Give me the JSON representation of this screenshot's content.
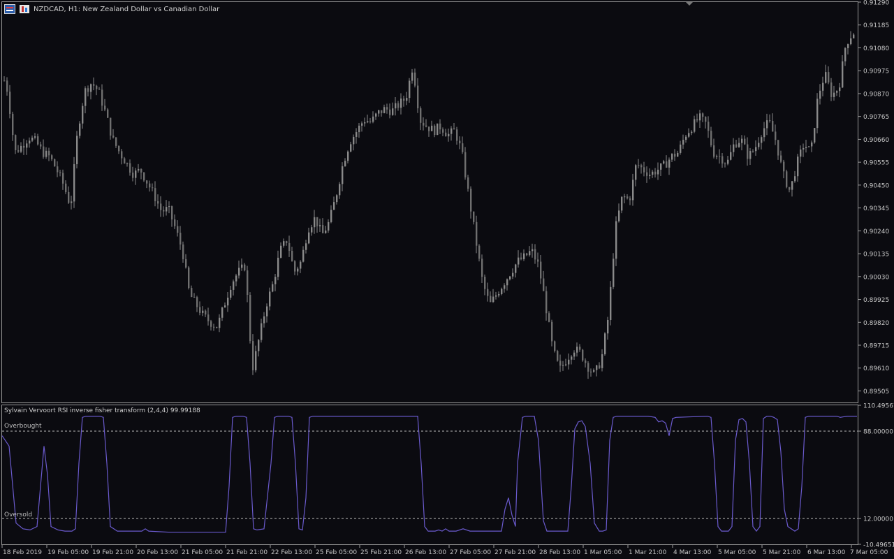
{
  "window": {
    "symbol_title": "NZDCAD, H1:  New Zealand Dollar vs Canadian Dollar",
    "icons": [
      "symbol-flag-icon",
      "timeframe-icon"
    ]
  },
  "price_axis": [
    "0.91290",
    "0.91185",
    "0.91080",
    "0.90975",
    "0.90870",
    "0.90765",
    "0.90660",
    "0.90555",
    "0.90450",
    "0.90345",
    "0.90240",
    "0.90135",
    "0.90030",
    "0.89925",
    "0.89820",
    "0.89715",
    "0.89610",
    "0.89505"
  ],
  "indicator": {
    "title": "Sylvain Vervoort RSI inverse fisher transform (2,4,4) 99.99188",
    "axis": [
      "110.49567",
      "88.00000",
      "12.00000",
      "-10.49651"
    ],
    "overbought_label": "Overbought",
    "oversold_label": "Oversold",
    "overbought_level": 88,
    "oversold_level": 12,
    "line_color": "#6a5acd"
  },
  "time_axis": [
    "18 Feb 2019",
    "19 Feb 05:00",
    "19 Feb 21:00",
    "20 Feb 13:00",
    "21 Feb 05:00",
    "21 Feb 21:00",
    "22 Feb 13:00",
    "25 Feb 05:00",
    "25 Feb 21:00",
    "26 Feb 13:00",
    "27 Feb 05:00",
    "27 Feb 21:00",
    "28 Feb 13:00",
    "1 Mar 05:00",
    "1 Mar 21:00",
    "4 Mar 13:00",
    "5 Mar 05:00",
    "5 Mar 21:00",
    "6 Mar 13:00",
    "7 Mar 05:00"
  ],
  "colors": {
    "background": "#0b0b10",
    "candle": "#8a8a8a",
    "grid_border": "#9a9a9a",
    "text": "#c8c8c8"
  },
  "chart_data": {
    "type": "candlestick",
    "price_range": [
      0.89452,
      0.9129
    ],
    "close_path": [
      [
        0,
        0.9098
      ],
      [
        10,
        0.9088
      ],
      [
        20,
        0.906
      ],
      [
        30,
        0.9063
      ],
      [
        40,
        0.9067
      ],
      [
        50,
        0.9065
      ],
      [
        60,
        0.906
      ],
      [
        70,
        0.9058
      ],
      [
        80,
        0.9052
      ],
      [
        90,
        0.9045
      ],
      [
        100,
        0.9035
      ],
      [
        110,
        0.907
      ],
      [
        120,
        0.9088
      ],
      [
        130,
        0.9092
      ],
      [
        140,
        0.9088
      ],
      [
        150,
        0.9078
      ],
      [
        160,
        0.9066
      ],
      [
        170,
        0.906
      ],
      [
        180,
        0.9055
      ],
      [
        190,
        0.905
      ],
      [
        200,
        0.9052
      ],
      [
        210,
        0.9046
      ],
      [
        220,
        0.904
      ],
      [
        230,
        0.9033
      ],
      [
        240,
        0.9034
      ],
      [
        250,
        0.9025
      ],
      [
        260,
        0.9015
      ],
      [
        270,
        0.8995
      ],
      [
        280,
        0.899
      ],
      [
        290,
        0.8985
      ],
      [
        300,
        0.8982
      ],
      [
        310,
        0.898
      ],
      [
        320,
        0.899
      ],
      [
        330,
        0.9
      ],
      [
        340,
        0.9005
      ],
      [
        350,
        0.9008
      ],
      [
        360,
        0.896
      ],
      [
        370,
        0.8975
      ],
      [
        380,
        0.899
      ],
      [
        390,
        0.9
      ],
      [
        400,
        0.9015
      ],
      [
        410,
        0.902
      ],
      [
        420,
        0.9005
      ],
      [
        430,
        0.901
      ],
      [
        440,
        0.9025
      ],
      [
        450,
        0.903
      ],
      [
        460,
        0.9022
      ],
      [
        470,
        0.9028
      ],
      [
        480,
        0.904
      ],
      [
        490,
        0.9055
      ],
      [
        500,
        0.9065
      ],
      [
        510,
        0.907
      ],
      [
        520,
        0.9075
      ],
      [
        530,
        0.9074
      ],
      [
        540,
        0.9078
      ],
      [
        550,
        0.908
      ],
      [
        560,
        0.9079
      ],
      [
        570,
        0.9082
      ],
      [
        580,
        0.9085
      ],
      [
        590,
        0.91
      ],
      [
        600,
        0.9075
      ],
      [
        610,
        0.9072
      ],
      [
        620,
        0.907
      ],
      [
        630,
        0.9072
      ],
      [
        640,
        0.9068
      ],
      [
        650,
        0.907
      ],
      [
        660,
        0.906
      ],
      [
        670,
        0.904
      ],
      [
        680,
        0.902
      ],
      [
        690,
        0.9
      ],
      [
        700,
        0.899
      ],
      [
        710,
        0.8995
      ],
      [
        720,
        0.9
      ],
      [
        730,
        0.9005
      ],
      [
        740,
        0.901
      ],
      [
        750,
        0.9012
      ],
      [
        760,
        0.9015
      ],
      [
        770,
        0.9008
      ],
      [
        780,
        0.899
      ],
      [
        790,
        0.897
      ],
      [
        800,
        0.896
      ],
      [
        810,
        0.8965
      ],
      [
        820,
        0.897
      ],
      [
        830,
        0.8968
      ],
      [
        840,
        0.8962
      ],
      [
        850,
        0.8958
      ],
      [
        860,
        0.8965
      ],
      [
        870,
        0.8985
      ],
      [
        880,
        0.9025
      ],
      [
        890,
        0.904
      ],
      [
        900,
        0.9038
      ],
      [
        910,
        0.9055
      ],
      [
        920,
        0.9052
      ],
      [
        930,
        0.905
      ],
      [
        940,
        0.9052
      ],
      [
        950,
        0.9054
      ],
      [
        960,
        0.9058
      ],
      [
        970,
        0.906
      ],
      [
        980,
        0.9068
      ],
      [
        990,
        0.9072
      ],
      [
        1000,
        0.9076
      ],
      [
        1010,
        0.9073
      ],
      [
        1020,
        0.906
      ],
      [
        1030,
        0.9058
      ],
      [
        1040,
        0.9055
      ],
      [
        1050,
        0.9064
      ],
      [
        1060,
        0.9066
      ],
      [
        1070,
        0.9058
      ],
      [
        1080,
        0.9062
      ],
      [
        1090,
        0.907
      ],
      [
        1100,
        0.9074
      ],
      [
        1110,
        0.9065
      ],
      [
        1120,
        0.905
      ],
      [
        1130,
        0.9042
      ],
      [
        1140,
        0.9055
      ],
      [
        1150,
        0.9064
      ],
      [
        1160,
        0.906
      ],
      [
        1170,
        0.9086
      ],
      [
        1180,
        0.9096
      ],
      [
        1190,
        0.9086
      ],
      [
        1200,
        0.909
      ],
      [
        1210,
        0.911
      ],
      [
        1220,
        0.9115
      ],
      [
        1224,
        0.9115
      ]
    ],
    "indicator_path": [
      [
        0,
        84
      ],
      [
        10,
        75
      ],
      [
        20,
        8
      ],
      [
        30,
        3
      ],
      [
        40,
        2
      ],
      [
        50,
        5
      ],
      [
        55,
        40
      ],
      [
        60,
        75
      ],
      [
        65,
        50
      ],
      [
        70,
        5
      ],
      [
        80,
        2
      ],
      [
        90,
        1
      ],
      [
        100,
        1
      ],
      [
        105,
        3
      ],
      [
        110,
        60
      ],
      [
        115,
        100
      ],
      [
        120,
        101
      ],
      [
        130,
        101
      ],
      [
        140,
        101
      ],
      [
        145,
        100
      ],
      [
        150,
        60
      ],
      [
        155,
        5
      ],
      [
        165,
        1
      ],
      [
        190,
        1
      ],
      [
        200,
        1
      ],
      [
        205,
        3
      ],
      [
        210,
        1
      ],
      [
        240,
        0
      ],
      [
        290,
        0
      ],
      [
        320,
        0
      ],
      [
        325,
        40
      ],
      [
        330,
        100
      ],
      [
        335,
        101
      ],
      [
        345,
        101
      ],
      [
        350,
        100
      ],
      [
        355,
        60
      ],
      [
        360,
        3
      ],
      [
        365,
        2
      ],
      [
        375,
        3
      ],
      [
        385,
        60
      ],
      [
        390,
        100
      ],
      [
        395,
        101
      ],
      [
        410,
        101
      ],
      [
        415,
        100
      ],
      [
        420,
        60
      ],
      [
        425,
        3
      ],
      [
        430,
        2
      ],
      [
        435,
        30
      ],
      [
        440,
        100
      ],
      [
        445,
        101
      ],
      [
        470,
        101
      ],
      [
        500,
        101
      ],
      [
        550,
        101
      ],
      [
        595,
        101
      ],
      [
        600,
        60
      ],
      [
        605,
        5
      ],
      [
        610,
        1
      ],
      [
        620,
        1
      ],
      [
        625,
        2
      ],
      [
        630,
        1
      ],
      [
        635,
        3
      ],
      [
        640,
        1
      ],
      [
        650,
        1
      ],
      [
        660,
        3
      ],
      [
        670,
        1
      ],
      [
        700,
        1
      ],
      [
        715,
        1
      ],
      [
        720,
        20
      ],
      [
        725,
        30
      ],
      [
        730,
        15
      ],
      [
        735,
        5
      ],
      [
        738,
        60
      ],
      [
        745,
        100
      ],
      [
        750,
        101
      ],
      [
        762,
        101
      ],
      [
        768,
        80
      ],
      [
        775,
        10
      ],
      [
        780,
        1
      ],
      [
        790,
        1
      ],
      [
        800,
        1
      ],
      [
        810,
        1
      ],
      [
        815,
        40
      ],
      [
        820,
        90
      ],
      [
        825,
        96
      ],
      [
        830,
        97
      ],
      [
        835,
        92
      ],
      [
        842,
        60
      ],
      [
        848,
        8
      ],
      [
        855,
        1
      ],
      [
        860,
        1
      ],
      [
        865,
        2
      ],
      [
        870,
        80
      ],
      [
        875,
        100
      ],
      [
        880,
        101
      ],
      [
        925,
        101
      ],
      [
        935,
        100
      ],
      [
        940,
        96
      ],
      [
        945,
        97
      ],
      [
        950,
        95
      ],
      [
        955,
        84
      ],
      [
        960,
        99
      ],
      [
        965,
        100
      ],
      [
        1010,
        101
      ],
      [
        1015,
        100
      ],
      [
        1020,
        60
      ],
      [
        1025,
        5
      ],
      [
        1030,
        1
      ],
      [
        1040,
        1
      ],
      [
        1045,
        5
      ],
      [
        1050,
        80
      ],
      [
        1055,
        98
      ],
      [
        1060,
        99
      ],
      [
        1065,
        96
      ],
      [
        1070,
        60
      ],
      [
        1075,
        5
      ],
      [
        1080,
        1
      ],
      [
        1085,
        5
      ],
      [
        1090,
        99
      ],
      [
        1095,
        101
      ],
      [
        1100,
        101
      ],
      [
        1105,
        100
      ],
      [
        1110,
        98
      ],
      [
        1115,
        70
      ],
      [
        1120,
        20
      ],
      [
        1125,
        5
      ],
      [
        1135,
        1
      ],
      [
        1140,
        3
      ],
      [
        1145,
        40
      ],
      [
        1150,
        100
      ],
      [
        1155,
        101
      ],
      [
        1195,
        101
      ],
      [
        1200,
        100
      ],
      [
        1210,
        101
      ],
      [
        1224,
        101
      ]
    ]
  }
}
